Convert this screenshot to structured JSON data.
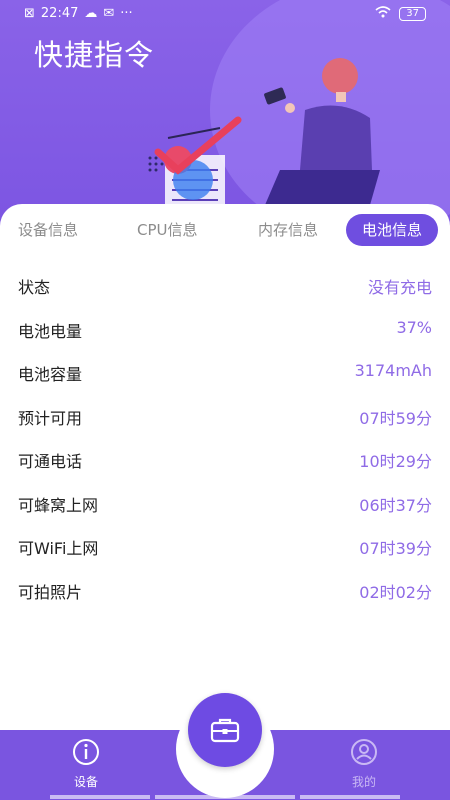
{
  "status_bar": {
    "time": "22:47",
    "battery": "37"
  },
  "header": {
    "title": "快捷指令"
  },
  "tabs": [
    {
      "label": "设备信息",
      "active": false
    },
    {
      "label": "CPU信息",
      "active": false
    },
    {
      "label": "内存信息",
      "active": false
    },
    {
      "label": "电池信息",
      "active": true
    }
  ],
  "battery_info": [
    {
      "label": "状态",
      "value": "没有充电"
    },
    {
      "label": "电池电量",
      "value": "37%"
    },
    {
      "label": "电池容量",
      "value": "3174mAh"
    },
    {
      "label": "预计可用",
      "value": "07时59分"
    },
    {
      "label": "可通电话",
      "value": "10时29分"
    },
    {
      "label": "可蜂窝上网",
      "value": "06时37分"
    },
    {
      "label": "可WiFi上网",
      "value": "07时39分"
    },
    {
      "label": "可拍照片",
      "value": "02时02分"
    }
  ],
  "bottom_nav": [
    {
      "label": "设备",
      "icon": "info-icon",
      "active": true
    },
    {
      "label": "我的",
      "icon": "profile-icon",
      "active": false
    }
  ],
  "colors": {
    "primary": "#7a55e0",
    "accent_text": "#8f6be6",
    "active_tab": "#6f4ee0"
  }
}
